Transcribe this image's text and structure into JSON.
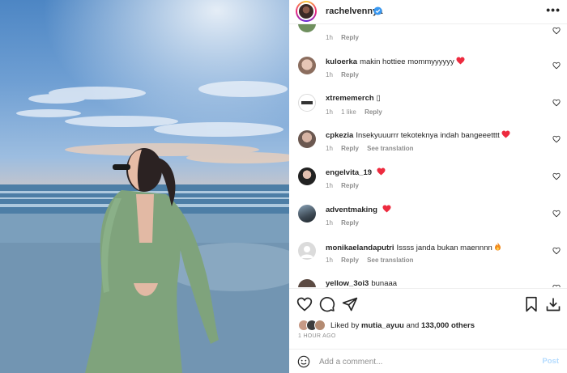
{
  "header": {
    "username": "rachelvennya",
    "more_label": "•••"
  },
  "comments": [
    {
      "username": "",
      "text": "",
      "time": "1h",
      "likes": "",
      "reply": "Reply",
      "translate": ""
    },
    {
      "username": "kuloerka",
      "text": "makin hottiee mommyyyyyy",
      "emoji": "heart",
      "time": "1h",
      "likes": "",
      "reply": "Reply",
      "translate": ""
    },
    {
      "username": "xtrememerch",
      "text": "▯",
      "time": "1h",
      "likes": "1 like",
      "reply": "Reply",
      "translate": ""
    },
    {
      "username": "cpkezia",
      "text": "Insekyuuurrr tekoteknya indah bangeeetttt",
      "emoji": "heart",
      "time": "1h",
      "likes": "",
      "reply": "Reply",
      "translate": "See translation"
    },
    {
      "username": "engelvita_19",
      "text": "",
      "emoji": "heart",
      "time": "1h",
      "likes": "",
      "reply": "Reply",
      "translate": ""
    },
    {
      "username": "adventmaking",
      "text": "",
      "emoji": "heart",
      "time": "1h",
      "likes": "",
      "reply": "Reply",
      "translate": ""
    },
    {
      "username": "monikaelandaputri",
      "text": "Issss janda bukan maennnn",
      "emoji": "fire",
      "time": "1h",
      "likes": "",
      "reply": "Reply",
      "translate": "See translation"
    },
    {
      "username": "yellow_3oi3",
      "text": "bunaaa",
      "time": "",
      "likes": "",
      "reply": "",
      "translate": ""
    }
  ],
  "likes": {
    "prefix": "Liked by",
    "user": "mutia_ayuu",
    "middle": "and",
    "count": "133,000 others"
  },
  "time_ago": "1 HOUR AGO",
  "add_comment": {
    "placeholder": "Add a comment...",
    "post_label": "Post"
  },
  "colors": {
    "heart": "#ed2b3f",
    "post_disabled": "#b3dbff",
    "muted": "#8e8e8e"
  }
}
